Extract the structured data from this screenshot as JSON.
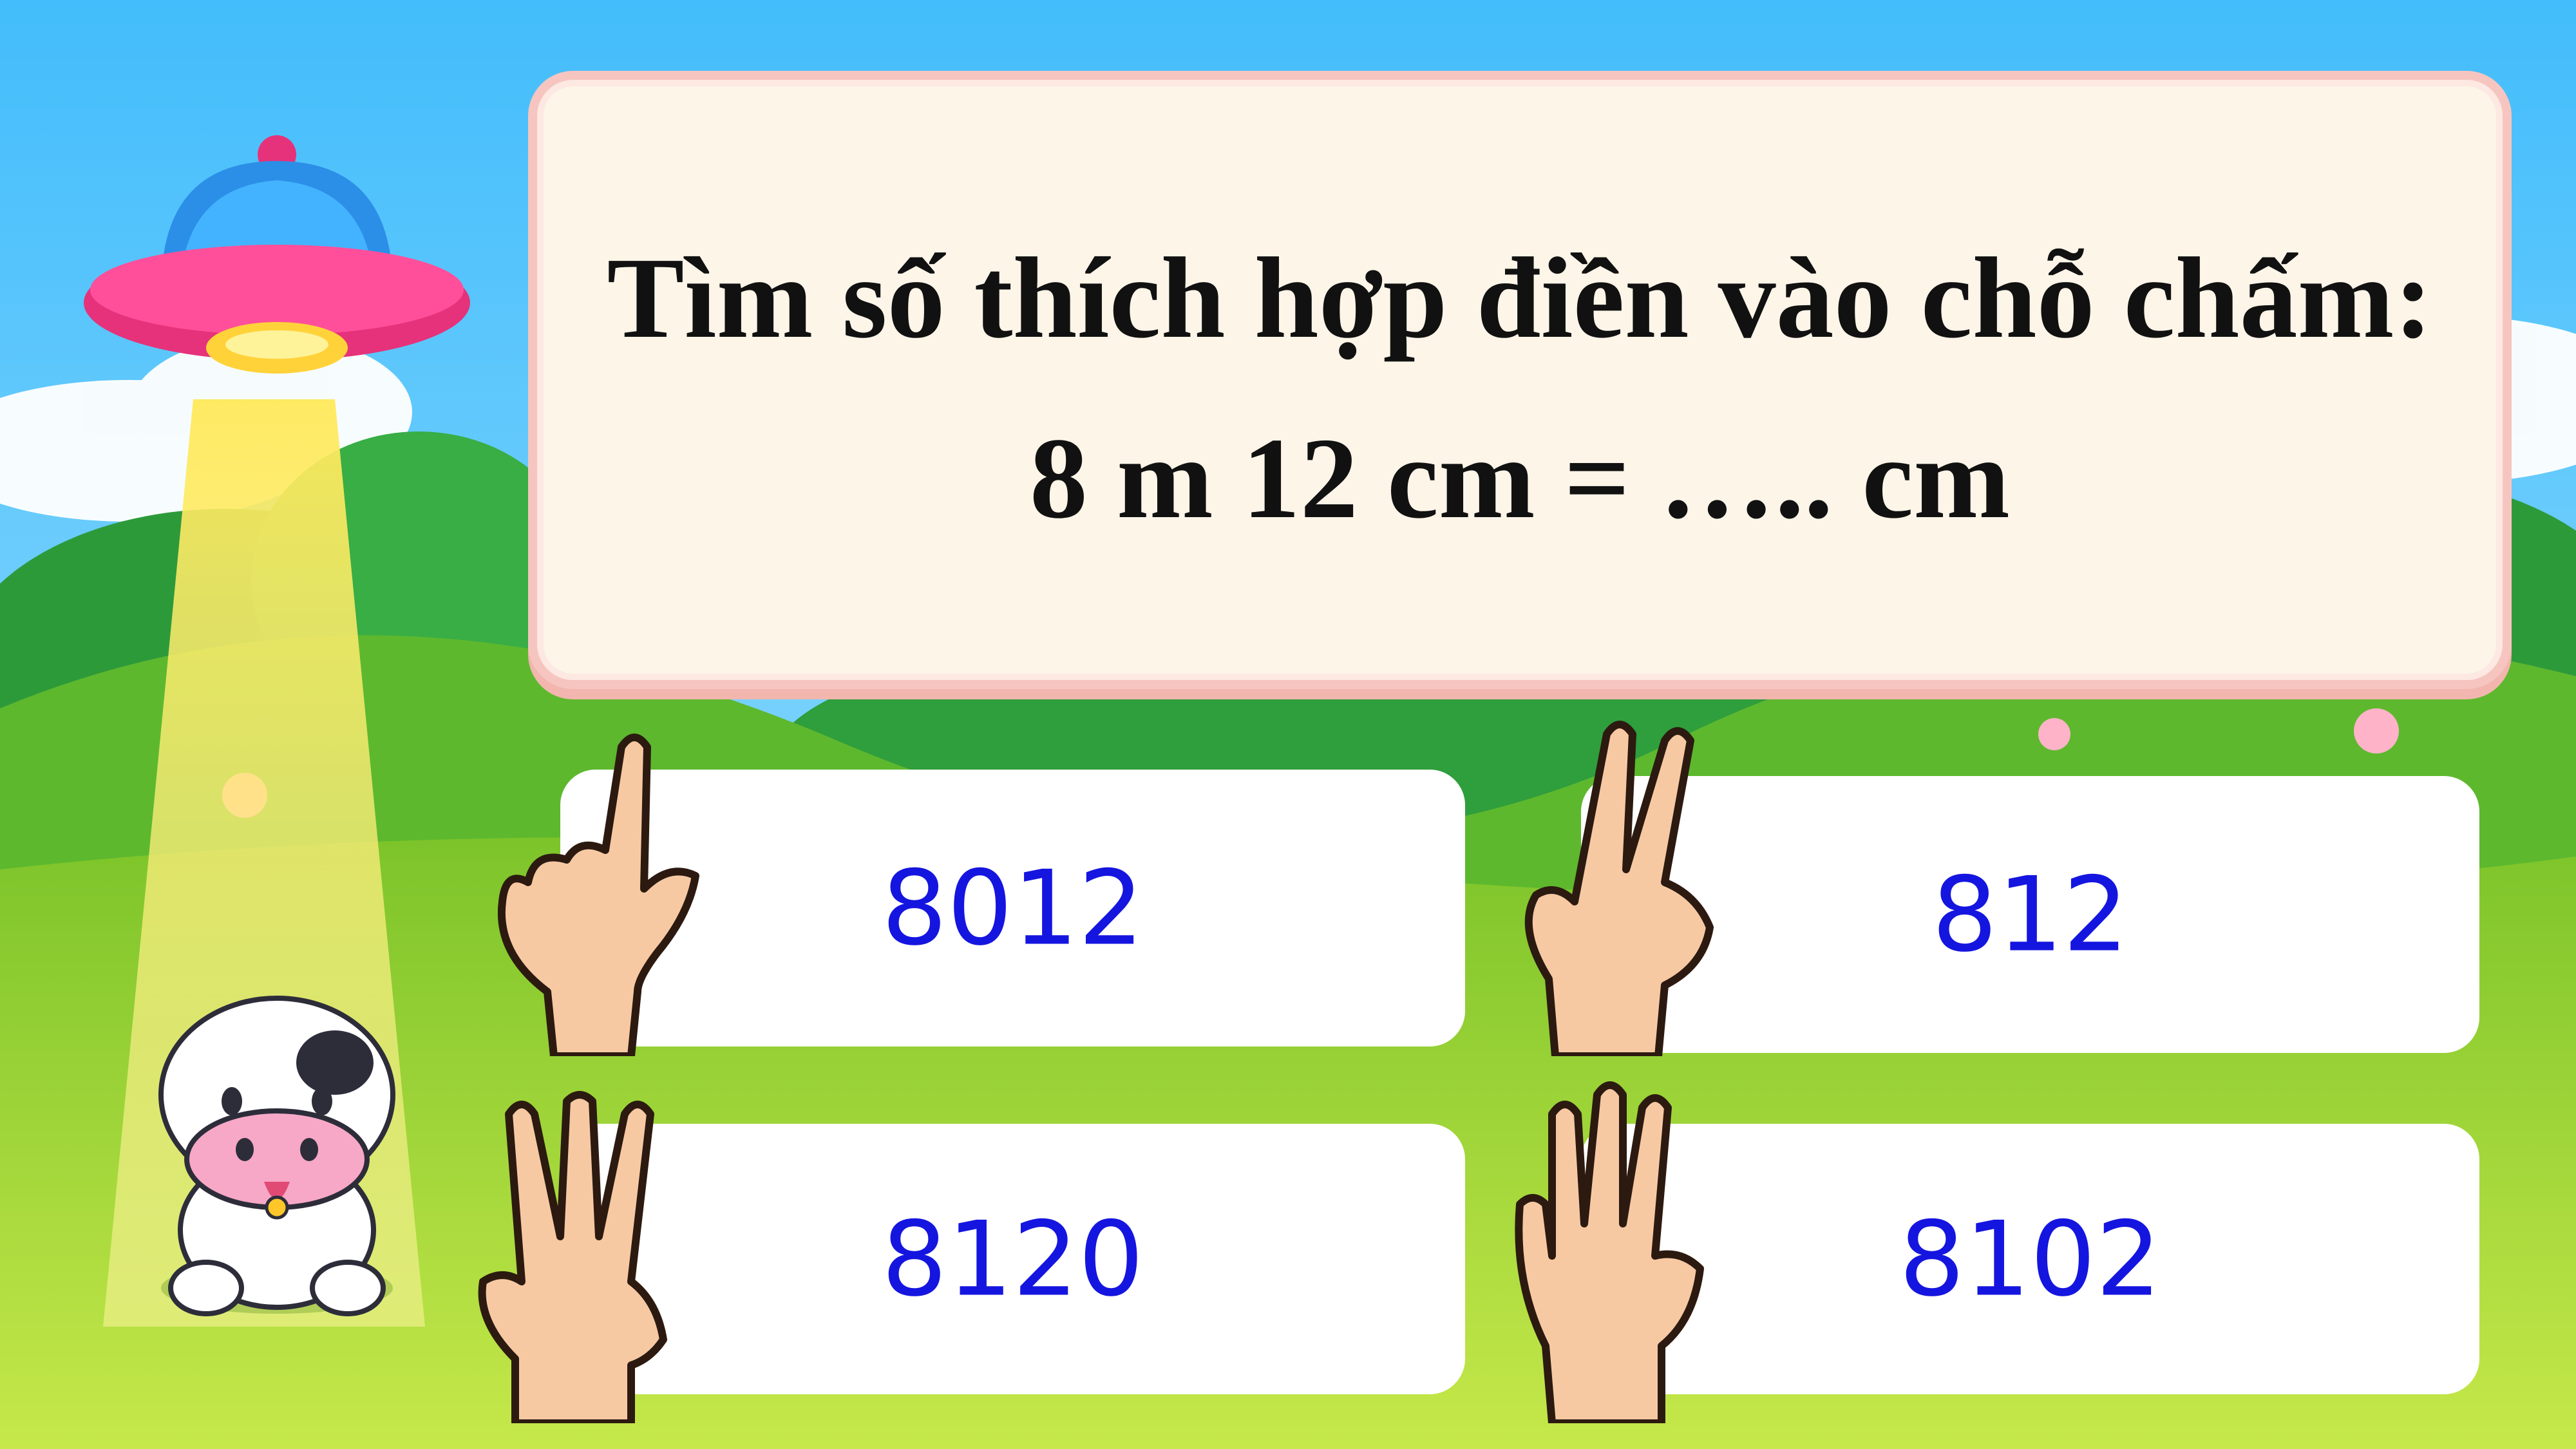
{
  "question": {
    "line1": "Tìm số thích hợp điền vào chỗ chấm:",
    "line2": "8 m 12 cm =  ….. cm"
  },
  "answers": [
    {
      "label": "8012",
      "hand_icon": "one-finger-hand-icon"
    },
    {
      "label": "812",
      "hand_icon": "two-finger-hand-icon"
    },
    {
      "label": "8120",
      "hand_icon": "three-finger-hand-icon"
    },
    {
      "label": "8102",
      "hand_icon": "five-finger-hand-icon"
    }
  ],
  "colors": {
    "sky": "#5bc8ff",
    "grass": "#8ed22a",
    "card_border": "#f6c5c0",
    "card_fill": "#fdf5e8",
    "answer_text": "#1515e0"
  },
  "decor": [
    "ufo-icon",
    "cow-icon",
    "tree-bushes",
    "hills"
  ]
}
